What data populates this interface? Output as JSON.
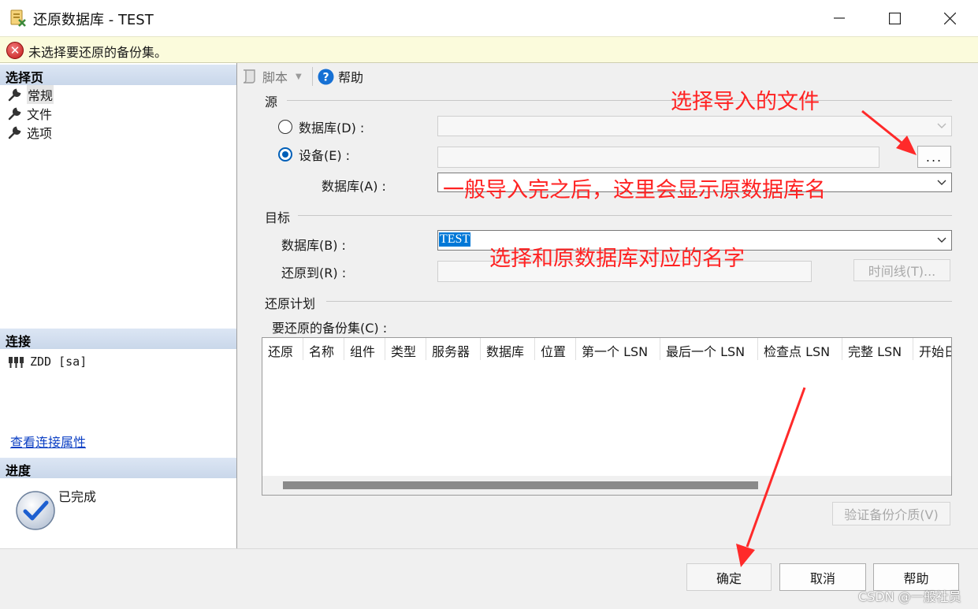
{
  "window": {
    "title": "还原数据库 - TEST",
    "minimize_glyph": "—",
    "maximize_glyph": "☐",
    "close_glyph": "✕"
  },
  "error_bar": {
    "icon": "error-x-icon",
    "text": "未选择要还原的备份集。"
  },
  "left": {
    "select_page_header": "选择页",
    "pages": [
      {
        "label": "常规",
        "icon": "wrench-icon",
        "selected": true
      },
      {
        "label": "文件",
        "icon": "wrench-icon",
        "selected": false
      },
      {
        "label": "选项",
        "icon": "wrench-icon",
        "selected": false
      }
    ],
    "connection_header": "连接",
    "connection_name": "ZDD [sa]",
    "view_connection_link": "查看连接属性",
    "progress_header": "进度",
    "progress_status": "已完成"
  },
  "toolbar": {
    "script_label": "脚本",
    "help_label": "帮助"
  },
  "source": {
    "group_label": "源",
    "database_radio_label": "数据库(D) :",
    "device_radio_label": "设备(E) :",
    "selected": "device",
    "browse_button": "...",
    "db_label": "数据库(A) :",
    "database_value": "",
    "device_value": "",
    "db_value": ""
  },
  "target": {
    "group_label": "目标",
    "db_label": "数据库(B) :",
    "db_value": "TEST",
    "restore_to_label": "还原到(R) :",
    "restore_to_value": "",
    "timeline_button": "时间线(T)..."
  },
  "plan": {
    "group_label": "还原计划",
    "backup_sets_label": "要还原的备份集(C) :",
    "columns": [
      "还原",
      "名称",
      "组件",
      "类型",
      "服务器",
      "数据库",
      "位置",
      "第一个 LSN",
      "最后一个 LSN",
      "检查点 LSN",
      "完整 LSN",
      "开始日"
    ],
    "rows": [],
    "verify_button": "验证备份介质(V)"
  },
  "buttons": {
    "ok": "确定",
    "cancel": "取消",
    "help": "帮助"
  },
  "annotations": {
    "select_file": "选择导入的文件",
    "after_import": "一般导入完之后，这里会显示原数据库名",
    "choose_name": "选择和原数据库对应的名字"
  },
  "watermark": "CSDN @一般社员",
  "colors": {
    "annotation": "#ff2222",
    "header_gradient": "#c9d7ea",
    "error_bar": "#fbfbdc",
    "selection": "#0078d7",
    "radio_accent": "#005fb8"
  }
}
